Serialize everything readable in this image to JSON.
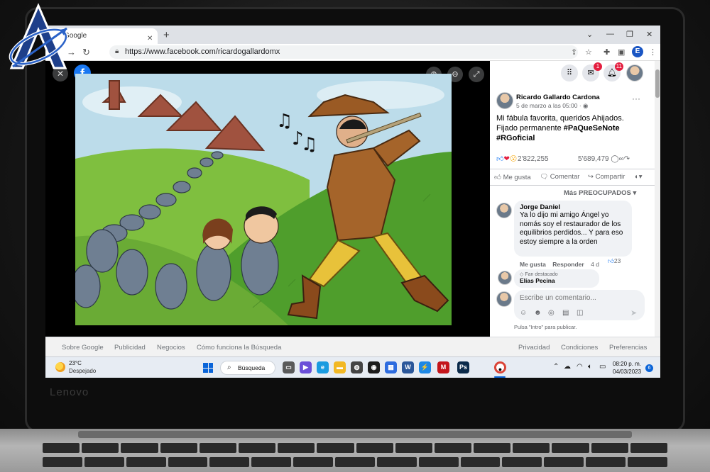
{
  "browser": {
    "tab_title": "Google",
    "url": "https://www.facebook.com/ricardogallardomx",
    "new_tab_symbol": "+",
    "profile_initial": "E"
  },
  "viewer": {
    "logo_letter": "f"
  },
  "facebook": {
    "messenger_badge": "1",
    "notifications_badge": "11",
    "post": {
      "author": "Ricardo Gallardo Cardona",
      "date": "5 de marzo a las 05:00 · ",
      "text_line1": "Mi fábula favorita, queridos Ahijados.",
      "text_line2": "Fijado permanente ",
      "hashtag1": "#PaQueSeNote",
      "hashtag2": "#RGoficial",
      "reaction_count": "2'822,255",
      "comment_count": "5'689,479",
      "like_label": "Me gusta",
      "comment_label": "Comentar",
      "share_label": "Compartir",
      "sort_label": "Más PREOCUPADOS"
    },
    "comments": [
      {
        "name": "Jorge Daniel",
        "text": "Ya lo dijo mi amigo Ángel yo nomás soy el restaurador de los equilibrios perdidos... Y para eso estoy siempre a la orden",
        "like": "Me gusta",
        "reply": "Responder",
        "age": "4 d",
        "reactions": "23"
      },
      {
        "badge": "Fan destacado",
        "name": "Elías Pecina"
      }
    ],
    "comment_placeholder": "Escribe un comentario...",
    "enter_hint": "Pulsa \"Intro\" para publicar."
  },
  "google_footer": {
    "about": "Sobre Google",
    "ads": "Publicidad",
    "business": "Negocios",
    "how_search": "Cómo funciona la Búsqueda",
    "privacy": "Privacidad",
    "terms": "Condiciones",
    "settings": "Preferencias"
  },
  "taskbar": {
    "temperature": "23°C",
    "condition": "Despejado",
    "search_label": "Búsqueda",
    "time": "08:20 p. m.",
    "date": "04/03/2023",
    "notification_count": "6"
  },
  "device": {
    "brand": "Lenovo"
  },
  "colors": {
    "facebook_blue": "#1877f2",
    "notification_red": "#e41e3f",
    "windows_blue": "#0a64d8"
  }
}
